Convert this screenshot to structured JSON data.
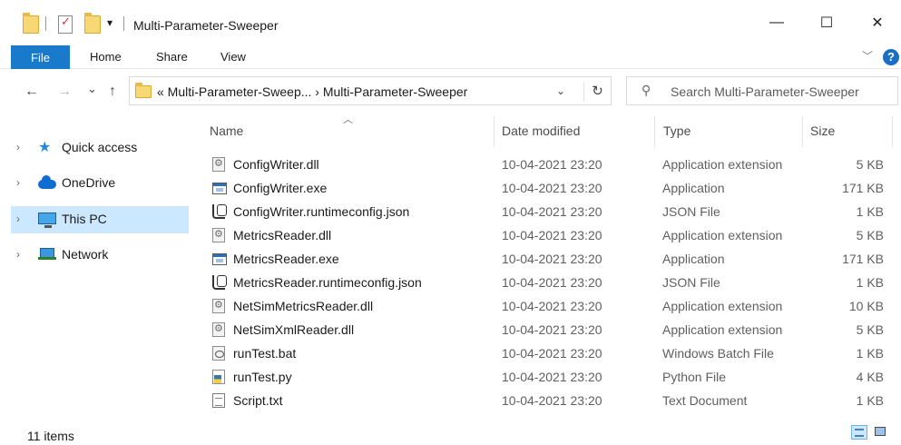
{
  "window": {
    "title": "Multi-Parameter-Sweeper",
    "controls": {
      "minimize": "—",
      "maximize": "☐",
      "close": "✕"
    }
  },
  "ribbon": {
    "tabs": [
      "File",
      "Home",
      "Share",
      "View"
    ],
    "help": "?"
  },
  "nav": {
    "back": "←",
    "forward": "→",
    "recent": "⌄",
    "up": "↑",
    "address": "« Multi-Parameter-Sweep...  ›  Multi-Parameter-Sweeper",
    "search_placeholder": "Search Multi-Parameter-Sweeper"
  },
  "sidebar": {
    "items": [
      {
        "label": "Quick access",
        "icon": "star-icon"
      },
      {
        "label": "OneDrive",
        "icon": "cloud-icon"
      },
      {
        "label": "This PC",
        "icon": "monitor-icon",
        "selected": true
      },
      {
        "label": "Network",
        "icon": "network-icon"
      }
    ]
  },
  "columns": [
    "Name",
    "Date modified",
    "Type",
    "Size"
  ],
  "files": [
    {
      "name": "ConfigWriter.dll",
      "date": "10-04-2021 23:20",
      "type": "Application extension",
      "size": "5 KB",
      "icon": "dll"
    },
    {
      "name": "ConfigWriter.exe",
      "date": "10-04-2021 23:20",
      "type": "Application",
      "size": "171 KB",
      "icon": "exe"
    },
    {
      "name": "ConfigWriter.runtimeconfig.json",
      "date": "10-04-2021 23:20",
      "type": "JSON File",
      "size": "1 KB",
      "icon": "json"
    },
    {
      "name": "MetricsReader.dll",
      "date": "10-04-2021 23:20",
      "type": "Application extension",
      "size": "5 KB",
      "icon": "dll"
    },
    {
      "name": "MetricsReader.exe",
      "date": "10-04-2021 23:20",
      "type": "Application",
      "size": "171 KB",
      "icon": "exe"
    },
    {
      "name": "MetricsReader.runtimeconfig.json",
      "date": "10-04-2021 23:20",
      "type": "JSON File",
      "size": "1 KB",
      "icon": "json"
    },
    {
      "name": "NetSimMetricsReader.dll",
      "date": "10-04-2021 23:20",
      "type": "Application extension",
      "size": "10 KB",
      "icon": "dll"
    },
    {
      "name": "NetSimXmlReader.dll",
      "date": "10-04-2021 23:20",
      "type": "Application extension",
      "size": "5 KB",
      "icon": "dll"
    },
    {
      "name": "runTest.bat",
      "date": "10-04-2021 23:20",
      "type": "Windows Batch File",
      "size": "1 KB",
      "icon": "bat"
    },
    {
      "name": "runTest.py",
      "date": "10-04-2021 23:20",
      "type": "Python File",
      "size": "4 KB",
      "icon": "py"
    },
    {
      "name": "Script.txt",
      "date": "10-04-2021 23:20",
      "type": "Text Document",
      "size": "1 KB",
      "icon": "txt"
    }
  ],
  "status": {
    "item_count": "11 items"
  },
  "colors": {
    "accent": "#1979ca",
    "selection": "#cce8ff"
  }
}
